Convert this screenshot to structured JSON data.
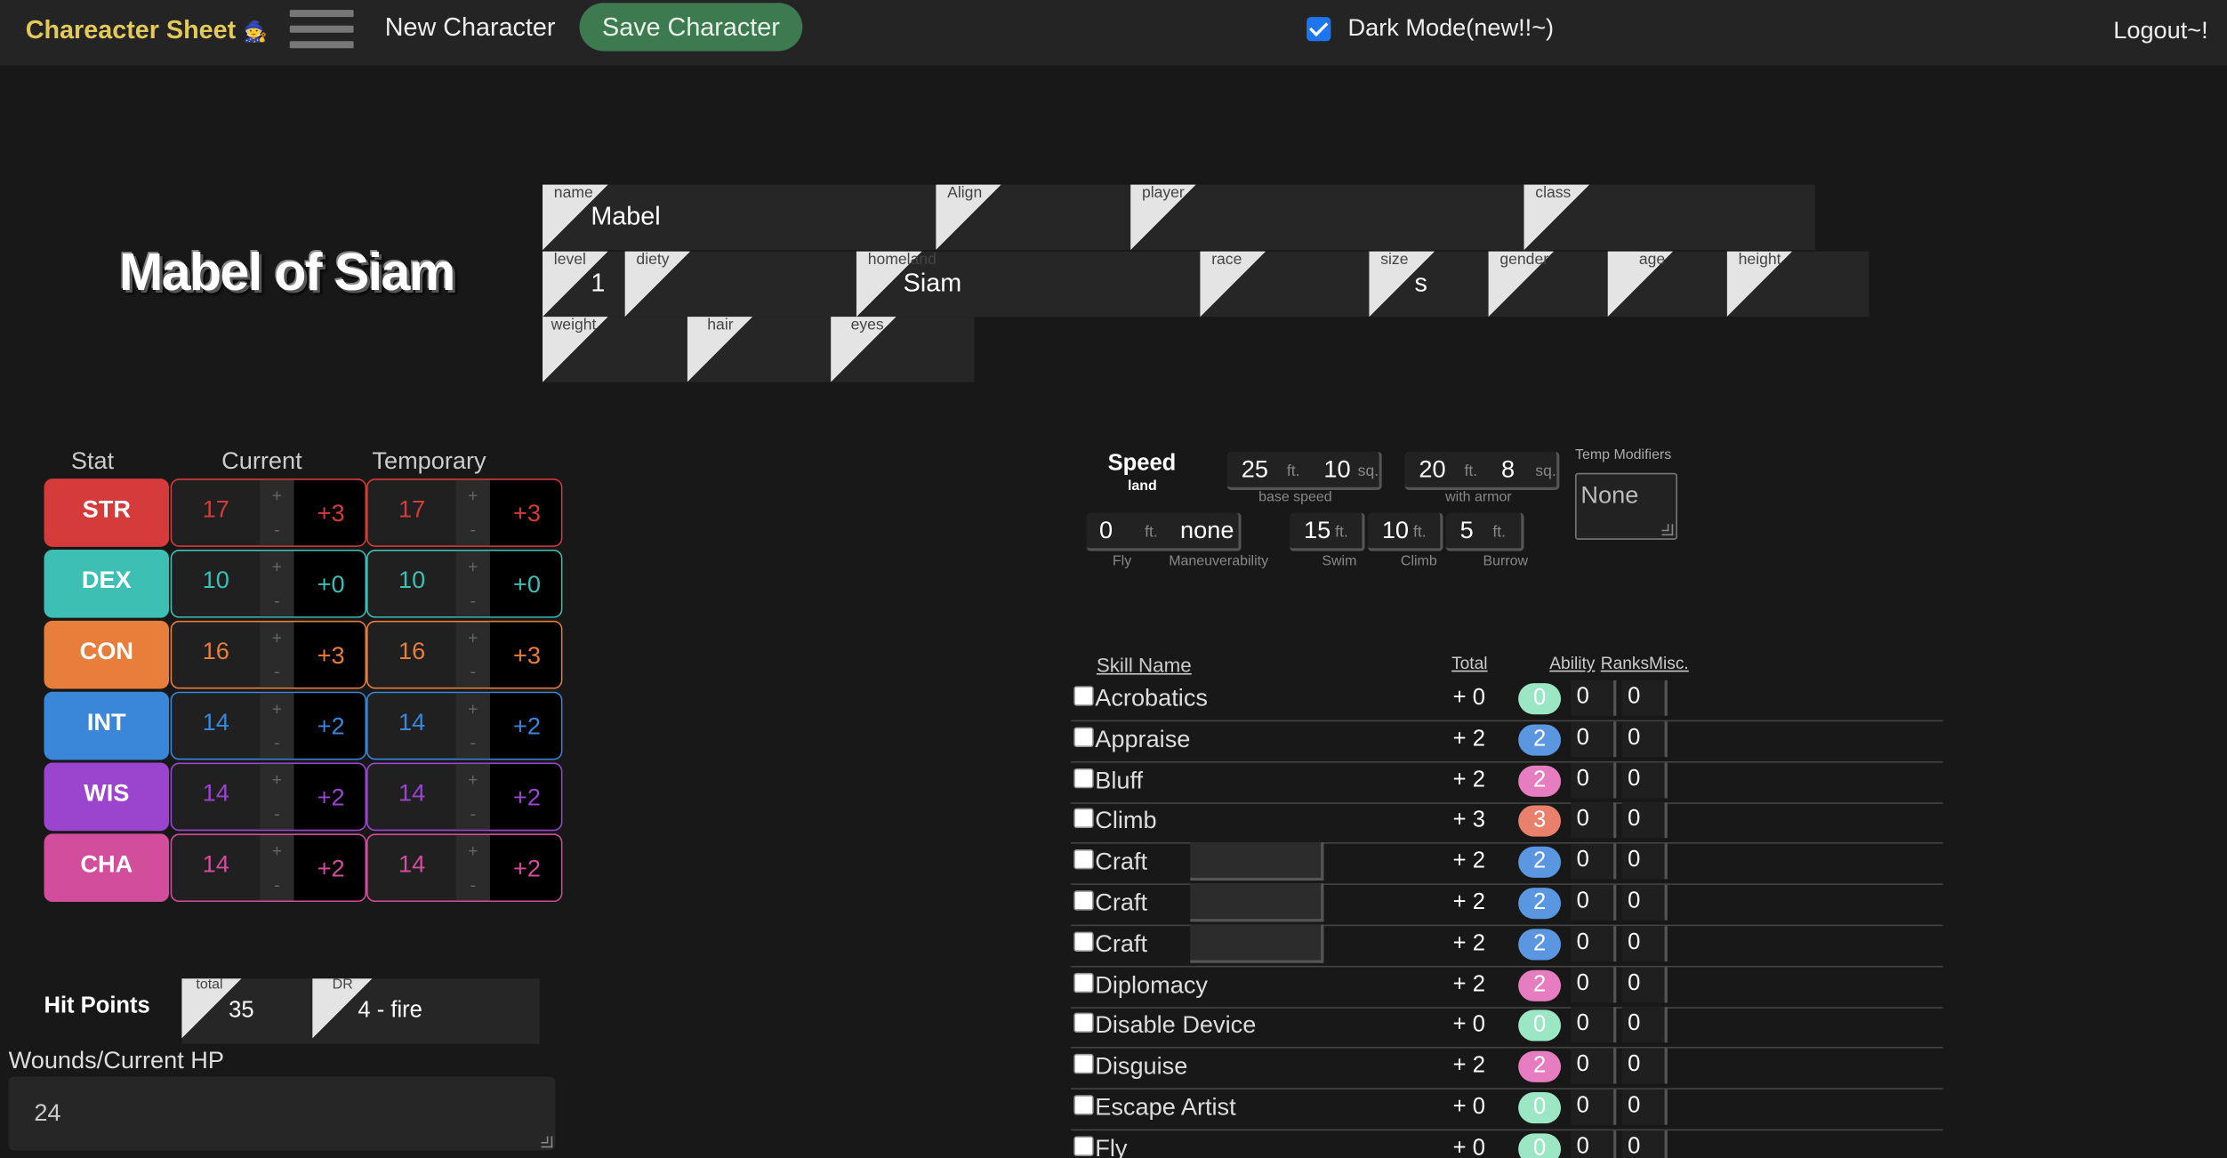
{
  "nav": {
    "brand_pre": "Chareacter Sheet",
    "brand_icon": "🧙",
    "new_character": "New Character",
    "save_character": "Save Character",
    "dark_mode_label": "Dark Mode(new!!~)",
    "dark_mode_checked": true,
    "logout": "Logout~!"
  },
  "title": "Mabel of Siam",
  "fields": {
    "name": {
      "label": "name",
      "value": "Mabel"
    },
    "align": {
      "label": "Align",
      "value": ""
    },
    "player": {
      "label": "player",
      "value": ""
    },
    "class": {
      "label": "class",
      "value": ""
    },
    "level": {
      "label": "level",
      "value": "1"
    },
    "diety": {
      "label": "diety",
      "value": ""
    },
    "homeland": {
      "label": "homeland",
      "value": "Siam"
    },
    "race": {
      "label": "race",
      "value": ""
    },
    "size": {
      "label": "size",
      "value": "s"
    },
    "gender": {
      "label": "gender",
      "value": ""
    },
    "age": {
      "label": "age",
      "value": ""
    },
    "height": {
      "label": "height",
      "value": ""
    },
    "weight": {
      "label": "weight",
      "value": ""
    },
    "hair": {
      "label": "hair",
      "value": ""
    },
    "eyes": {
      "label": "eyes",
      "value": ""
    }
  },
  "stats": {
    "headers": {
      "stat": "Stat",
      "current": "Current",
      "temporary": "Temporary"
    },
    "plus": "+",
    "minus": "-",
    "rows": [
      {
        "name": "STR",
        "current": "17",
        "current_mod": "+3",
        "temp": "17",
        "temp_mod": "+3",
        "color": "#d63b3b"
      },
      {
        "name": "DEX",
        "current": "10",
        "current_mod": "+0",
        "temp": "10",
        "temp_mod": "+0",
        "color": "#3dbfb3"
      },
      {
        "name": "CON",
        "current": "16",
        "current_mod": "+3",
        "temp": "16",
        "temp_mod": "+3",
        "color": "#e87e3c"
      },
      {
        "name": "INT",
        "current": "14",
        "current_mod": "+2",
        "temp": "14",
        "temp_mod": "+2",
        "color": "#3a86d9"
      },
      {
        "name": "WIS",
        "current": "14",
        "current_mod": "+2",
        "temp": "14",
        "temp_mod": "+2",
        "color": "#9b45cf"
      },
      {
        "name": "CHA",
        "current": "14",
        "current_mod": "+2",
        "temp": "14",
        "temp_mod": "+2",
        "color": "#d24d9c"
      }
    ]
  },
  "hp": {
    "label": "Hit Points",
    "total_label": "total",
    "total": "35",
    "dr_label": "DR",
    "dr": "4 - fire",
    "wounds_label": "Wounds/Current HP",
    "wounds": "24"
  },
  "speed": {
    "title": "Speed",
    "subtitle": "land",
    "base": "25",
    "base_sq": "10",
    "base_caption": "base speed",
    "armor": "20",
    "armor_sq": "8",
    "armor_caption": "with armor",
    "ft": "ft.",
    "sq": "sq.",
    "fly": "0",
    "fly_caption": "Fly",
    "maneuverability": "none",
    "maneuverability_caption": "Maneuverability",
    "swim": "15",
    "swim_caption": "Swim",
    "climb": "10",
    "climb_caption": "Climb",
    "burrow": "5",
    "burrow_caption": "Burrow",
    "temp_label": "Temp Modifiers",
    "temp_value": "None"
  },
  "skills": {
    "headers": {
      "name": "Skill Name",
      "total": "Total",
      "ability": "Ability",
      "ranks": "Ranks",
      "misc": "Misc."
    },
    "rows": [
      {
        "name": "Acrobatics",
        "total": "+ 0",
        "ability": "0",
        "ranks": "0",
        "misc": "0",
        "color": "#9be6c4",
        "sub": false
      },
      {
        "name": "Appraise",
        "total": "+ 2",
        "ability": "2",
        "ranks": "0",
        "misc": "0",
        "color": "#5b96e0",
        "sub": false
      },
      {
        "name": "Bluff",
        "total": "+ 2",
        "ability": "2",
        "ranks": "0",
        "misc": "0",
        "color": "#e67dc0",
        "sub": false
      },
      {
        "name": "Climb",
        "total": "+ 3",
        "ability": "3",
        "ranks": "0",
        "misc": "0",
        "color": "#e8806c",
        "sub": false
      },
      {
        "name": "Craft",
        "total": "+ 2",
        "ability": "2",
        "ranks": "0",
        "misc": "0",
        "color": "#5b96e0",
        "sub": true
      },
      {
        "name": "Craft",
        "total": "+ 2",
        "ability": "2",
        "ranks": "0",
        "misc": "0",
        "color": "#5b96e0",
        "sub": true
      },
      {
        "name": "Craft",
        "total": "+ 2",
        "ability": "2",
        "ranks": "0",
        "misc": "0",
        "color": "#5b96e0",
        "sub": true
      },
      {
        "name": "Diplomacy",
        "total": "+ 2",
        "ability": "2",
        "ranks": "0",
        "misc": "0",
        "color": "#e67dc0",
        "sub": false
      },
      {
        "name": "Disable Device",
        "total": "+ 0",
        "ability": "0",
        "ranks": "0",
        "misc": "0",
        "color": "#9be6c4",
        "sub": false
      },
      {
        "name": "Disguise",
        "total": "+ 2",
        "ability": "2",
        "ranks": "0",
        "misc": "0",
        "color": "#e67dc0",
        "sub": false
      },
      {
        "name": "Escape Artist",
        "total": "+ 0",
        "ability": "0",
        "ranks": "0",
        "misc": "0",
        "color": "#9be6c4",
        "sub": false
      },
      {
        "name": "Fly",
        "total": "+ 0",
        "ability": "0",
        "ranks": "0",
        "misc": "0",
        "color": "#9be6c4",
        "sub": false
      }
    ]
  }
}
